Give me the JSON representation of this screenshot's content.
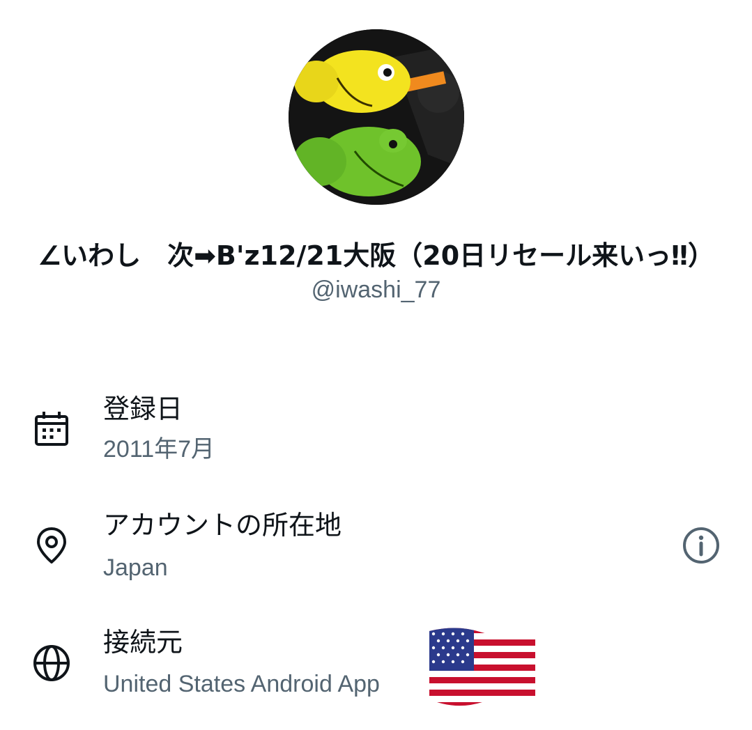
{
  "profile": {
    "avatar_alt": "yellow and green chameleon plush toys",
    "display_name": "∠いわし　次➡B'z12/21大阪（20日リセール来いっ‼）",
    "handle": "@iwashi_77"
  },
  "about": {
    "joined": {
      "icon": "calendar-icon",
      "label": "登録日",
      "value": "2011年7月"
    },
    "location": {
      "icon": "location-pin-icon",
      "label": "アカウントの所在地",
      "value": "Japan",
      "info_icon": "info-icon"
    },
    "connected_via": {
      "icon": "globe-icon",
      "label": "接続元",
      "value": "United States Android App",
      "flag_icon": "us-flag-icon"
    }
  },
  "colors": {
    "primary_text": "#0f1419",
    "secondary_text": "#536471",
    "background": "#ffffff"
  }
}
